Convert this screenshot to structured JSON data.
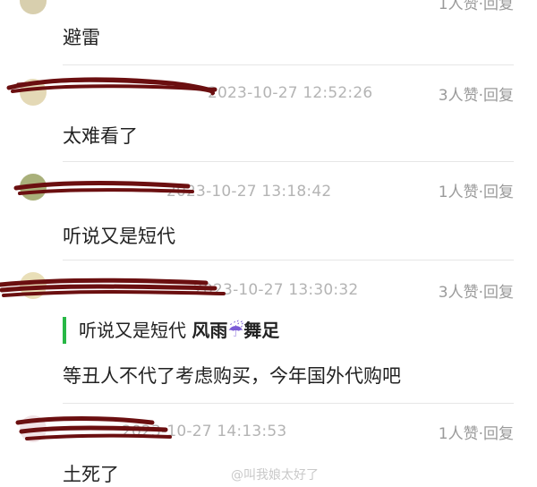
{
  "comments": [
    {
      "username": "",
      "timestamp": "",
      "likes": "1人赞",
      "separator": " · ",
      "reply": "回复",
      "text": "避雷"
    },
    {
      "username": "",
      "timestamp": "2023-10-27 12:52:26",
      "likes": "3人赞",
      "separator": " · ",
      "reply": "回复",
      "text": "太难看了"
    },
    {
      "username": "",
      "timestamp": "2023-10-27 13:18:42",
      "likes": "1人赞",
      "separator": " · ",
      "reply": "回复",
      "text": "听说又是短代"
    },
    {
      "username": "",
      "timestamp": "2023-10-27 13:30:32",
      "likes": "3人赞",
      "separator": " · ",
      "reply": "回复",
      "quote_text": "听说又是短代",
      "quote_author_a": "风雨",
      "quote_author_emoji": "☔",
      "quote_author_b": "舞足",
      "text": "等丑人不代了考虑购买，今年国外代购吧"
    },
    {
      "username": "",
      "timestamp": "2023-10-27 14:13:53",
      "likes": "1人赞",
      "separator": " · ",
      "reply": "回复",
      "text": "土死了"
    }
  ],
  "watermark": "@叫我娘太好了",
  "colors": {
    "quote_bar": "#28b846",
    "redaction": "#6b0f10"
  }
}
